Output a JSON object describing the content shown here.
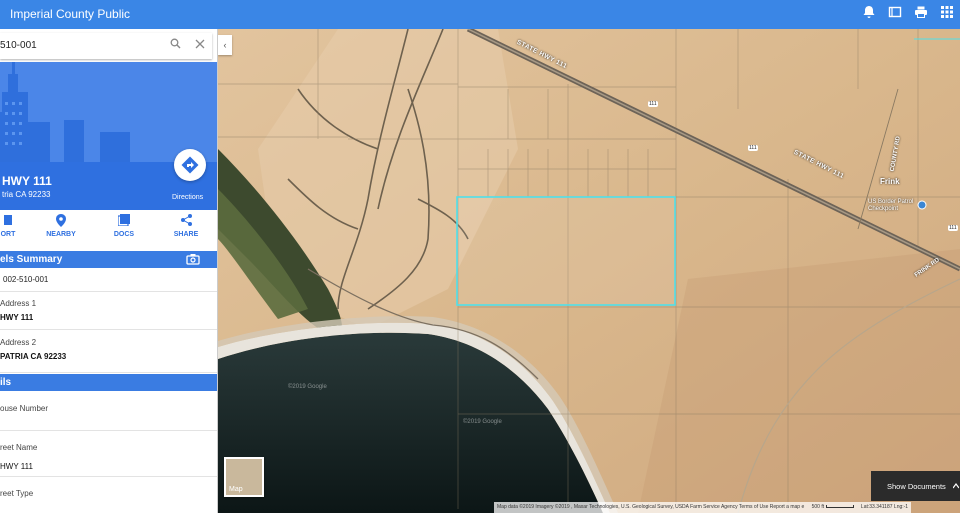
{
  "app": {
    "title": "Imperial County Public"
  },
  "topbar_icons": [
    "bell-icon",
    "book-icon",
    "print-icon",
    "apps-grid-icon"
  ],
  "search": {
    "value": "510-001"
  },
  "property": {
    "street": "HWY 111",
    "city": "tria CA 92233",
    "directions_label": "Directions"
  },
  "actions": [
    {
      "label": "ORT",
      "icon": "report-icon"
    },
    {
      "label": "NEARBY",
      "icon": "pin-icon"
    },
    {
      "label": "DOCS",
      "icon": "docs-icon"
    },
    {
      "label": "SHARE",
      "icon": "share-icon"
    }
  ],
  "parcels_summary": {
    "heading": "els Summary",
    "rows": [
      {
        "label": "",
        "value": "002-510-001"
      },
      {
        "label": "Address 1",
        "value": "HWY 111"
      },
      {
        "label": "Address 2",
        "value": "PATRIA CA 92233"
      }
    ]
  },
  "details": {
    "heading": "ils",
    "rows": [
      {
        "label": "ouse Number",
        "value": ""
      },
      {
        "label": "reet Name",
        "value": "HWY 111"
      },
      {
        "label": "reet Type",
        "value": ""
      }
    ]
  },
  "map": {
    "labels": {
      "hwy_top": "STATE HWY 111",
      "hwy_right": "STATE HWY 111",
      "shield1": "111",
      "shield2": "111",
      "shield3": "111",
      "county_rd": "COUNTY RD",
      "frink": "Frink",
      "checkpoint": "US Border Patrol Checkpoint",
      "frink_rd": "FRINK RD",
      "google": "©2019 Google",
      "google2": "©2019 Google"
    },
    "thumb_label": "Map",
    "attribution": "Map data ©2019 Imagery ©2019 , Maxar Technologies, U.S. Geological Survey, USDA Farm Service Agency   Terms of Use   Report a map e",
    "scale": "500 ft",
    "coords": "Lat:33.341187   Lng:-1",
    "show_documents": "Show Documents"
  }
}
